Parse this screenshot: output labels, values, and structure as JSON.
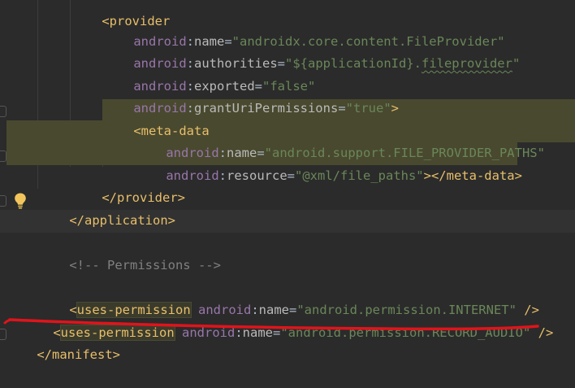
{
  "lines": {
    "l0": {
      "open": "<",
      "name": "provider",
      "close": ""
    },
    "l1": {
      "ns": "android",
      "colon": ":",
      "attr": "name",
      "eq": "=",
      "value": "\"androidx.core.content.FileProvider\""
    },
    "l2": {
      "ns": "android",
      "colon": ":",
      "attr": "authorities",
      "eq": "=",
      "value_a": "\"${applicationId}.",
      "value_b": "fileprovider",
      "value_c": "\""
    },
    "l3": {
      "ns": "android",
      "colon": ":",
      "attr": "exported",
      "eq": "=",
      "value": "\"false\""
    },
    "l4": {
      "ns": "android",
      "colon": ":",
      "attr": "grantUriPermissions",
      "eq": "=",
      "value": "\"true\"",
      "end": ">"
    },
    "l5": {
      "open": "<",
      "name": "meta-data"
    },
    "l6": {
      "ns": "android",
      "colon": ":",
      "attr": "name",
      "eq": "=",
      "value": "\"android.support.FILE_PROVIDER_PATHS\""
    },
    "l7": {
      "ns": "android",
      "colon": ":",
      "attr": "resource",
      "eq": "=",
      "value": "\"@xml/file_paths\"",
      "end": "></",
      "close_name": "meta-data",
      "close_end": ">"
    },
    "l8": {
      "open": "</",
      "name": "provider",
      "end": ">"
    },
    "l9": {
      "open": "</",
      "name": "application",
      "end": ">"
    },
    "l11": {
      "comment": "<!-- Permissions -->"
    },
    "l13": {
      "open": "<",
      "name": "uses-permission",
      "ns": "android",
      "colon": ":",
      "attr": "name",
      "eq": "=",
      "value": "\"android.permission.INTERNET\"",
      "end": " />"
    },
    "l14": {
      "open": "<",
      "name": "uses-permission",
      "ns": "android",
      "colon": ":",
      "attr": "name",
      "eq": "=",
      "value": "\"android.permission.RECORD_AUDIO\"",
      "end": " />"
    },
    "l15": {
      "open": "</",
      "name": "manifest",
      "end": ">"
    }
  },
  "colors": {
    "background": "#2b2b2b",
    "tag": "#e8bf6a",
    "namespace": "#9876aa",
    "attribute": "#bababa",
    "string": "#6a8759",
    "comment": "#808080",
    "highlight": "#49492f",
    "annotation_underline": "#e0141b"
  },
  "icons": {
    "gutter_intention": "lightbulb-icon"
  }
}
